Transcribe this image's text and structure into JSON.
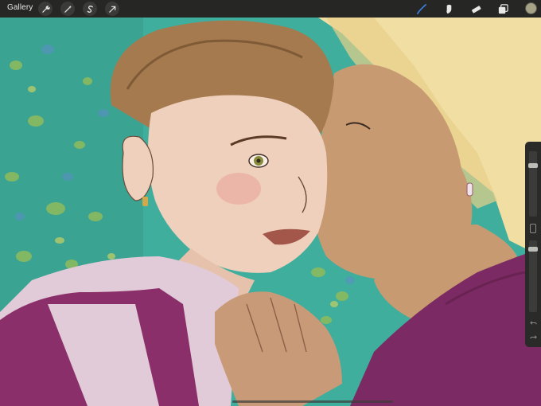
{
  "topbar": {
    "gallery_label": "Gallery",
    "left_tools": [
      {
        "name": "actions-wrench-icon"
      },
      {
        "name": "adjustments-wand-icon"
      },
      {
        "name": "selection-s-icon"
      },
      {
        "name": "transform-arrow-icon"
      }
    ],
    "right_tools": [
      {
        "name": "brush-icon",
        "active": true
      },
      {
        "name": "smudge-icon"
      },
      {
        "name": "eraser-icon"
      },
      {
        "name": "layers-icon"
      }
    ],
    "active_color": "#a5a286",
    "accent_color": "#3d7fe0"
  },
  "sidebar": {
    "brush_size_level": 0.2,
    "opacity_level": 0.1
  }
}
